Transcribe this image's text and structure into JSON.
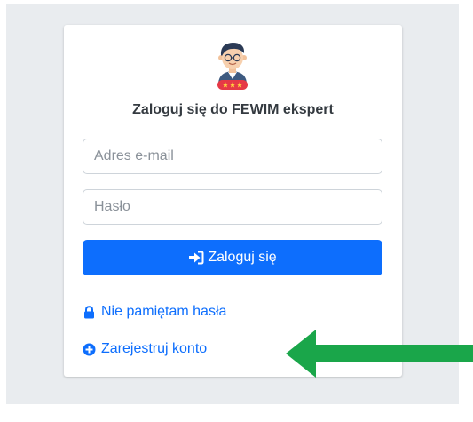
{
  "login": {
    "title": "Zaloguj się do FEWIM ekspert",
    "email_placeholder": "Adres e-mail",
    "password_placeholder": "Hasło",
    "submit_label": "Zaloguj się"
  },
  "links": {
    "forgot_password": "Nie pamiętam hasła",
    "register": "Zarejestruj konto"
  },
  "icons": {
    "logo": "expert-avatar-icon",
    "submit": "sign-in-icon",
    "forgot": "lock-icon",
    "register": "plus-circle-icon",
    "annotation": "green-arrow-icon"
  },
  "colors": {
    "primary": "#0d6efd",
    "arrow": "#1aa64a",
    "backdrop": "#e9ecef"
  }
}
